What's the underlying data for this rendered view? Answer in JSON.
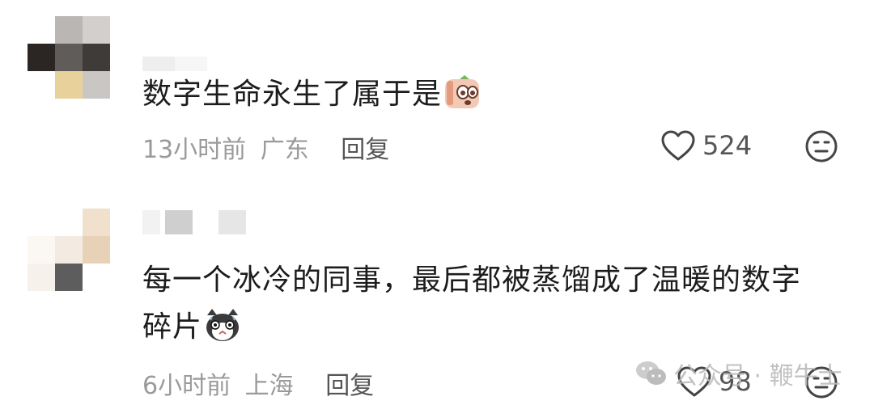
{
  "comments": [
    {
      "text": "数字生命永生了属于是",
      "time": "13小时前",
      "location": "广东",
      "reply_label": "回复",
      "likes": "524",
      "sticker_icon": "face-peeking-icon",
      "sticker_color": "#e7a890"
    },
    {
      "text_line1": "每一个冰冷的同事，最后都被蒸馏成了温暖的数字",
      "text_line2": "碎片",
      "time": "6小时前",
      "location": "上海",
      "reply_label": "回复",
      "likes": "98",
      "sticker_icon": "cat-shocked-icon",
      "sticker_color": "#333333"
    }
  ],
  "watermark": {
    "text": "公众号 · 鞭牛士",
    "icon": "wechat-icon"
  },
  "icons": {
    "like": "heart-outline-icon",
    "dislike": "neutral-face-icon"
  },
  "colors": {
    "meta_gray": "#9a9a9a",
    "text": "#1c1c1c",
    "icon": "#444444"
  }
}
